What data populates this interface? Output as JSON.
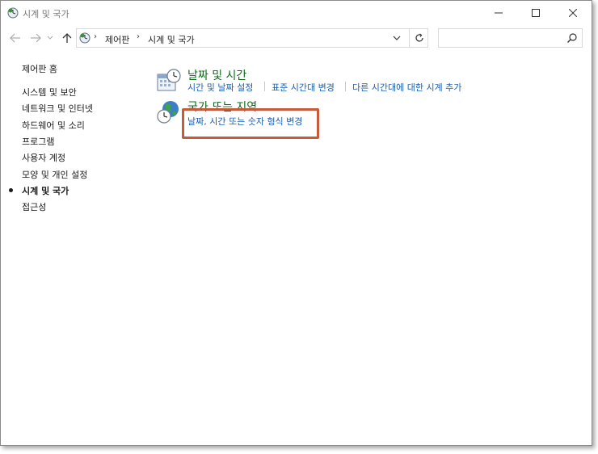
{
  "window": {
    "title": "시계 및 국가",
    "controls": {
      "minimize": "—",
      "maximize": "☐",
      "close": "✕"
    }
  },
  "address_bar": {
    "breadcrumbs": [
      "제어판",
      "시계 및 국가"
    ],
    "search_placeholder": ""
  },
  "sidebar": {
    "home": "제어판 홈",
    "items": [
      {
        "label": "시스템 및 보안",
        "active": false
      },
      {
        "label": "네트워크 및 인터넷",
        "active": false
      },
      {
        "label": "하드웨어 및 소리",
        "active": false
      },
      {
        "label": "프로그램",
        "active": false
      },
      {
        "label": "사용자 계정",
        "active": false
      },
      {
        "label": "모양 및 개인 설정",
        "active": false
      },
      {
        "label": "시계 및 국가",
        "active": true
      },
      {
        "label": "접근성",
        "active": false
      }
    ]
  },
  "main": {
    "categories": [
      {
        "title": "날짜 및 시간",
        "icon": "calendar-clock-icon",
        "links": [
          "시간 및 날짜 설정",
          "표준 시간대 변경",
          "다른 시간대에 대한 시계 추가"
        ]
      },
      {
        "title": "국가 또는 지역",
        "icon": "globe-clock-icon",
        "links": [
          "날짜, 시간 또는 숫자 형식 변경"
        ]
      }
    ]
  },
  "colors": {
    "category_title": "#0f6b1a",
    "link": "#1a5fb4",
    "highlight_box": "#c65a3a"
  }
}
